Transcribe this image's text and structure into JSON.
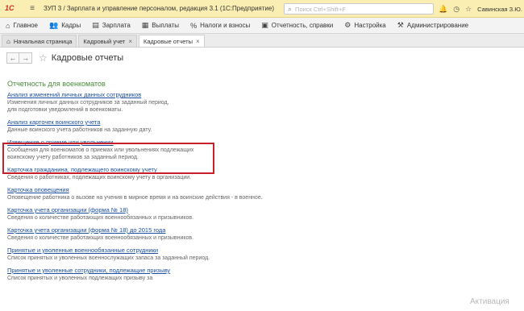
{
  "titlebar": {
    "logo": "1С",
    "app_title": "ЗУП 3 / Зарплата и управление персоналом, редакция 3.1  (1С:Предприятие)",
    "search_placeholder": "Поиск Ctrl+Shift+F",
    "user": "Савинская З.Ю. (Сис"
  },
  "menu": [
    {
      "icon": "home-icon",
      "glyph": "⌂",
      "label": "Главное"
    },
    {
      "icon": "people-icon",
      "glyph": "👥",
      "label": "Кадры"
    },
    {
      "icon": "money-icon",
      "glyph": "▤",
      "label": "Зарплата"
    },
    {
      "icon": "payout-icon",
      "glyph": "▦",
      "label": "Выплаты"
    },
    {
      "icon": "percent-icon",
      "glyph": "%",
      "label": "Налоги и взносы"
    },
    {
      "icon": "reports-icon",
      "glyph": "▣",
      "label": "Отчетность, справки"
    },
    {
      "icon": "gear-icon",
      "glyph": "⚙",
      "label": "Настройка"
    },
    {
      "icon": "tools-icon",
      "glyph": "⚒",
      "label": "Администрирование"
    }
  ],
  "tabs": {
    "home": "Начальная страница",
    "hr_accounting": "Кадровый учет",
    "hr_reports": "Кадровые отчеты"
  },
  "page": {
    "back": "←",
    "forward": "→",
    "title": "Кадровые отчеты"
  },
  "group_title": "Отчетность для военкоматов",
  "reports": [
    {
      "title": "Анализ изменений личных данных сотрудников",
      "desc": "Изменения личных данных сотрудников за заданный период,\nдля подготовки уведомлений в военкоматы."
    },
    {
      "title": "Анализ карточек воинского учета",
      "desc": "Данные воинского учета работников на заданную дату."
    },
    {
      "title": "Извещение о приеме или увольнении",
      "desc": "Сообщения для военкоматов о приемах или увольнениях подлежащих\nвоинскому учету работников за заданный период."
    },
    {
      "title": "Карточка гражданина, подлежащего воинскому учету",
      "desc": "Сведения о работниках, подлежащих воинскому учету в организации."
    },
    {
      "title": "Карточка оповещения",
      "desc": "Оповещение работника о вызове на учения в мирное время и на воинские действия - в военное."
    },
    {
      "title": "Карточка учета организации (форма № 18)",
      "desc": "Сведения о количестве работающих военнообязанных и призывников."
    },
    {
      "title": "Карточка учета организации (форма № 18) до 2015 года",
      "desc": "Сведения о количестве работающих военнообязанных и призывников."
    },
    {
      "title": "Принятые и уволенные военнообязанные сотрудники",
      "desc": "Список принятых и уволенных военнослужащих запаса за заданный период."
    },
    {
      "title": "Принятые и уволенные сотрудники, подлежащие призыву",
      "desc": "Список принятых и уволенных подлежащих призыву за"
    }
  ],
  "watermark": "Активация"
}
